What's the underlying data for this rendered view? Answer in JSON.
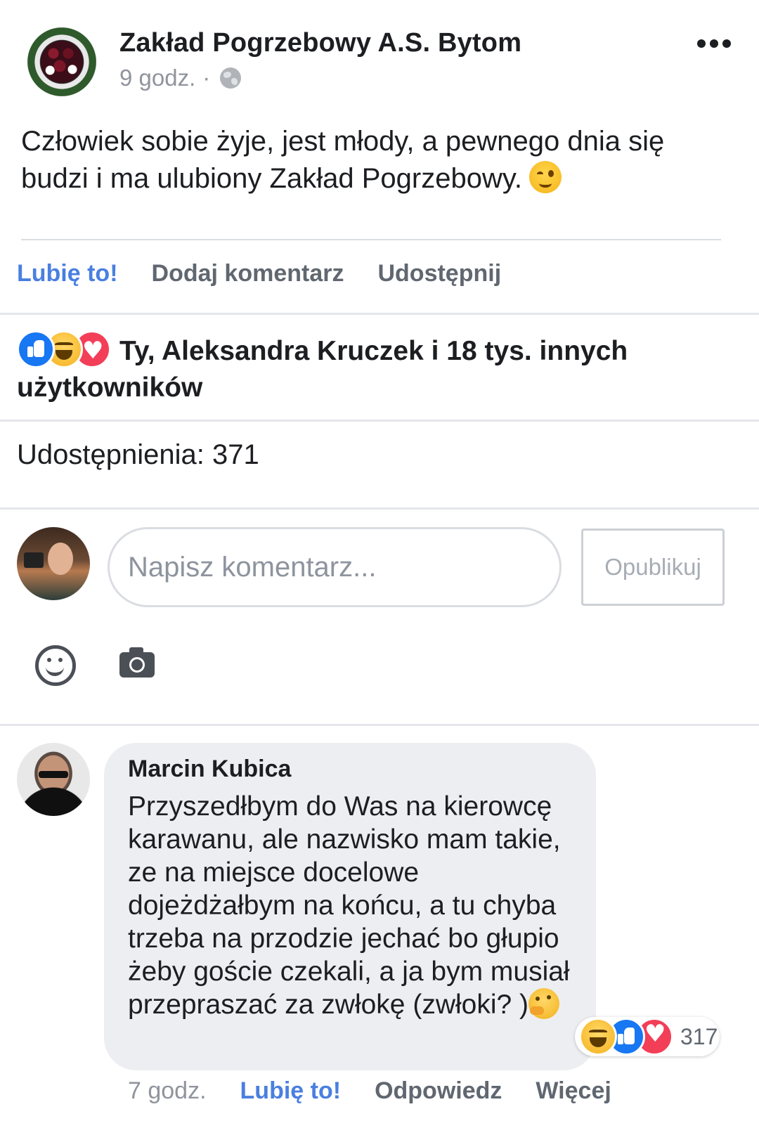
{
  "post": {
    "page_name": "Zakład Pogrzebowy A.S. Bytom",
    "time": "9 godz.",
    "meta_separator": "·",
    "text": "Człowiek sobie żyje, jest młody, a pewnego dnia się budzi i ma ulubiony Zakład Pogrzebowy.",
    "text_emoji": "wink-emoji"
  },
  "actions": {
    "like": "Lubię to!",
    "comment": "Dodaj komentarz",
    "share": "Udostępnij"
  },
  "reactions": {
    "icons": [
      "like-icon",
      "haha-icon",
      "love-icon"
    ],
    "summary": "Ty, Aleksandra Kruczek i 18 tys. innych użytkowników"
  },
  "shares": {
    "text": "Udostępnienia: 371"
  },
  "composer": {
    "placeholder": "Napisz komentarz...",
    "publish_label": "Opublikuj",
    "icons": [
      "smile-icon",
      "camera-icon"
    ]
  },
  "comment": {
    "author": "Marcin Kubica",
    "text": "Przyszedłbym do Was na kierowcę karawanu, ale nazwisko mam takie, ze na miejsce docelowe dojeżdżałbym na końcu, a tu chyba trzeba na przodzie jechać bo głupio żeby goście czekali, a ja bym musiał przepraszać za zwłokę (zwłoki? )",
    "text_emoji": "thinking-emoji",
    "reaction_count": "317",
    "time": "7 godz.",
    "like_label": "Lubię to!",
    "reply_label": "Odpowiedz",
    "more_label": "Więcej"
  },
  "colors": {
    "accent": "#4a7fe0",
    "like_blue": "#1877f2",
    "love_red": "#f33e58",
    "bubble_bg": "#edeef1"
  }
}
